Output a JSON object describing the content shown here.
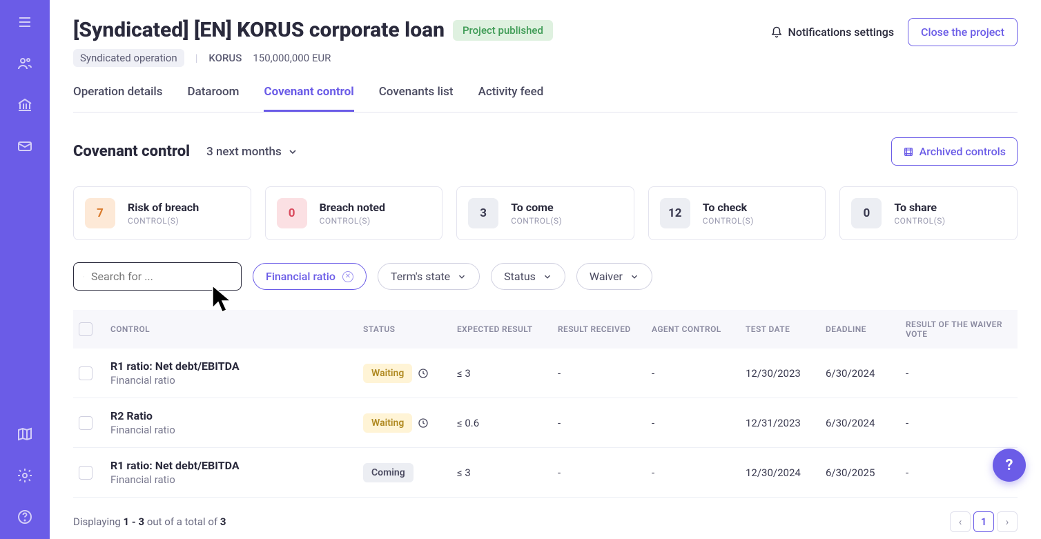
{
  "header": {
    "title": "[Syndicated] [EN] KORUS corporate loan",
    "published_badge": "Project published",
    "meta_chip": "Syndicated operation",
    "company": "KORUS",
    "amount": "150,000,000 EUR",
    "notifications": "Notifications settings",
    "close": "Close the project"
  },
  "tabs": [
    {
      "label": "Operation details"
    },
    {
      "label": "Dataroom"
    },
    {
      "label": "Covenant control",
      "active": true
    },
    {
      "label": "Covenants list"
    },
    {
      "label": "Activity feed"
    }
  ],
  "section": {
    "title": "Covenant control",
    "period": "3 next months",
    "archived": "Archived controls"
  },
  "cards": [
    {
      "count": "7",
      "label": "Risk of breach",
      "sub": "CONTROL(S)",
      "variant": "risk"
    },
    {
      "count": "0",
      "label": "Breach noted",
      "sub": "CONTROL(S)",
      "variant": "breach"
    },
    {
      "count": "3",
      "label": "To come",
      "sub": "CONTROL(S)",
      "variant": "neutral"
    },
    {
      "count": "12",
      "label": "To check",
      "sub": "CONTROL(S)",
      "variant": "neutral"
    },
    {
      "count": "0",
      "label": "To share",
      "sub": "CONTROL(S)",
      "variant": "neutral"
    }
  ],
  "filters": {
    "search_placeholder": "Search for ...",
    "active_pill": "Financial ratio",
    "pills": [
      "Term's state",
      "Status",
      "Waiver"
    ]
  },
  "table": {
    "headers": {
      "control": "CONTROL",
      "status": "STATUS",
      "expected": "EXPECTED RESULT",
      "received": "RESULT RECEIVED",
      "agent": "AGENT CONTROL",
      "test": "TEST DATE",
      "deadline": "DEADLINE",
      "waiver": "RESULT OF THE WAIVER VOTE"
    },
    "rows": [
      {
        "name": "R1 ratio: Net debt/EBITDA",
        "sub": "Financial ratio",
        "status": "Waiting",
        "status_variant": "waiting",
        "clock": true,
        "expected": "≤ 3",
        "received": "-",
        "agent": "-",
        "test": "12/30/2023",
        "deadline": "6/30/2024",
        "waiver": "-"
      },
      {
        "name": "R2 Ratio",
        "sub": "Financial ratio",
        "status": "Waiting",
        "status_variant": "waiting",
        "clock": true,
        "expected": "≤ 0.6",
        "received": "-",
        "agent": "-",
        "test": "12/31/2023",
        "deadline": "6/30/2024",
        "waiver": "-"
      },
      {
        "name": "R1 ratio: Net debt/EBITDA",
        "sub": "Financial ratio",
        "status": "Coming",
        "status_variant": "coming",
        "clock": false,
        "expected": "≤ 3",
        "received": "-",
        "agent": "-",
        "test": "12/30/2024",
        "deadline": "6/30/2025",
        "waiver": "-"
      }
    ]
  },
  "footer": {
    "prefix": "Displaying ",
    "range": "1 - 3",
    "mid": " out of a total of ",
    "total": "3",
    "page": "1"
  }
}
